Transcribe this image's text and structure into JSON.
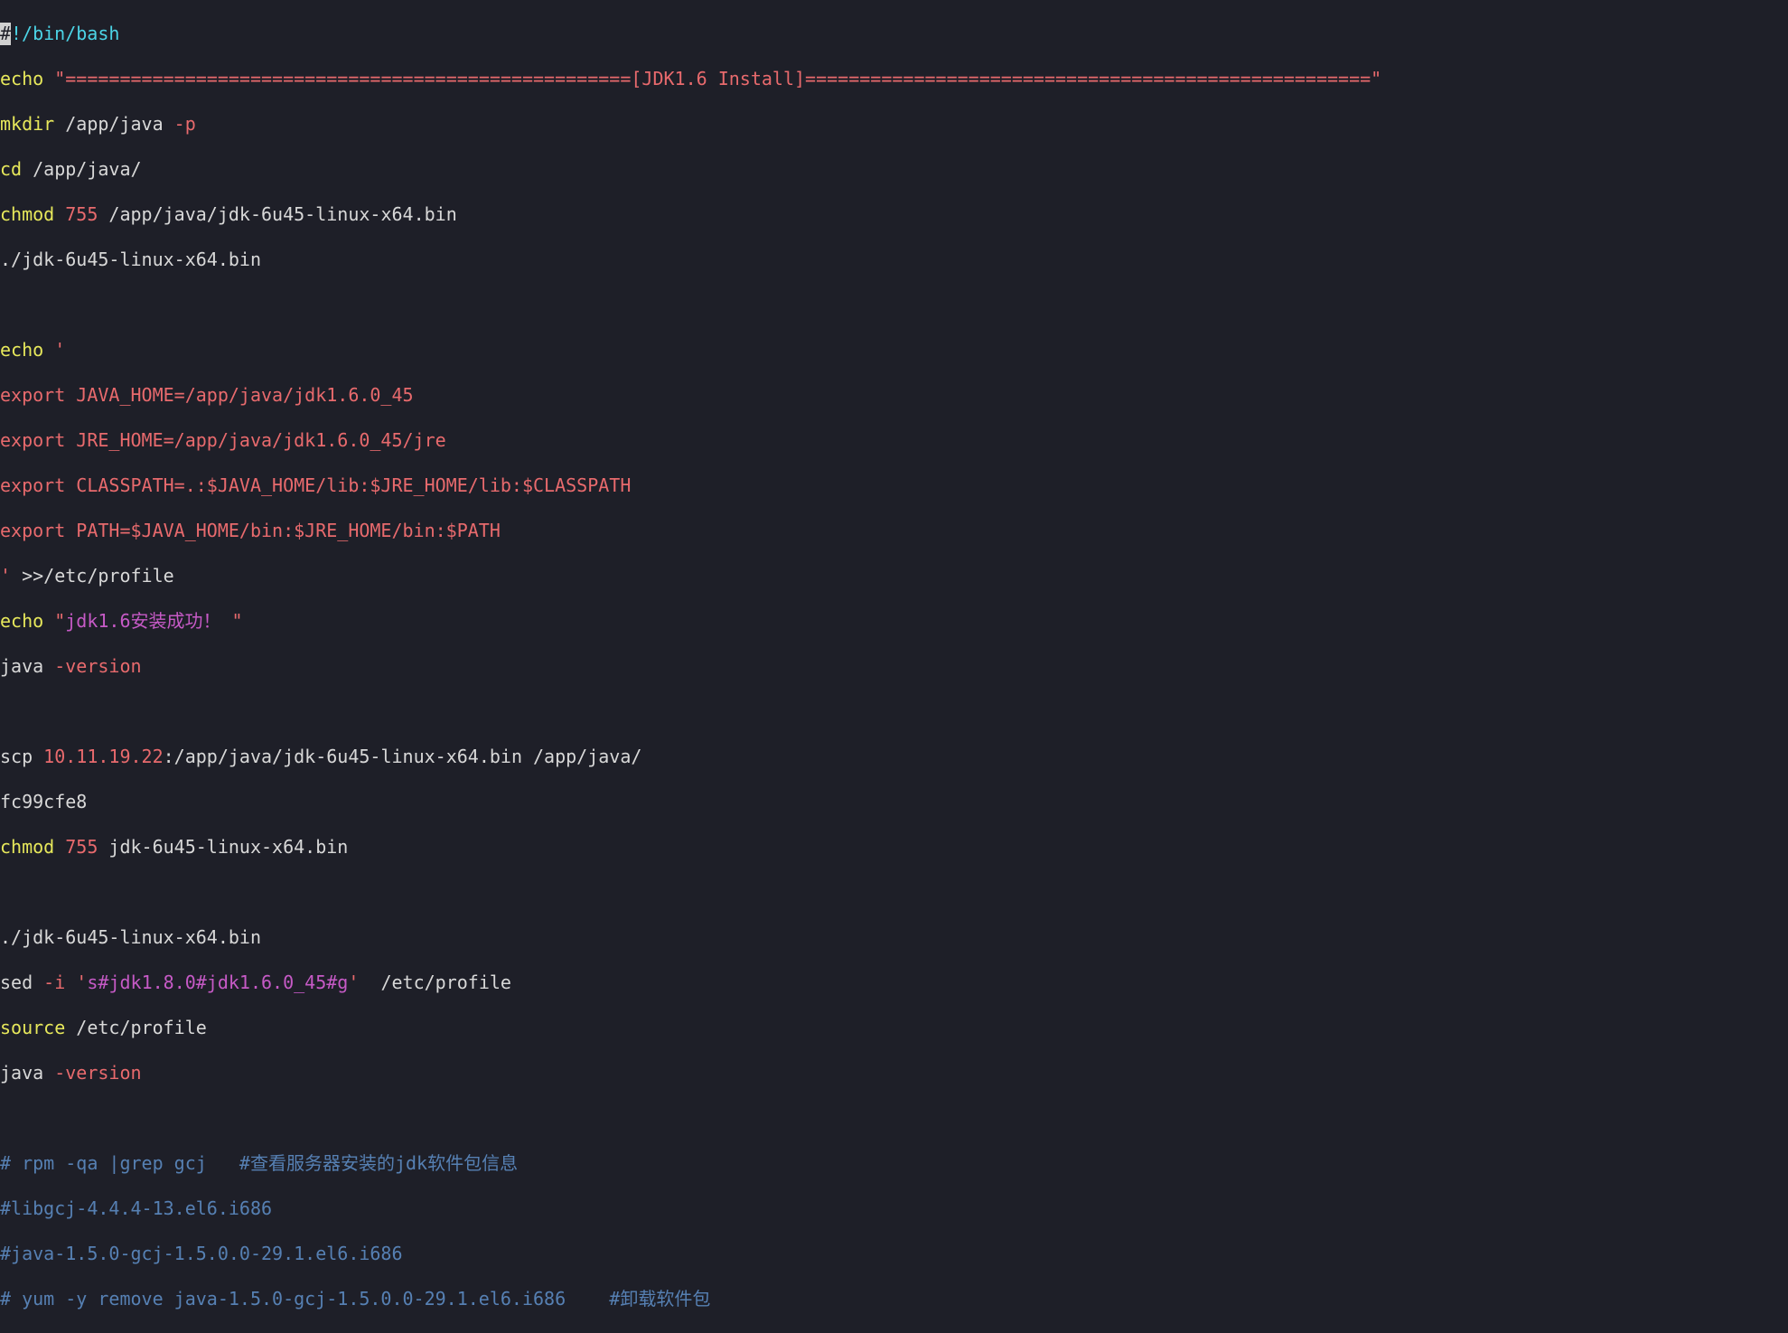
{
  "lines": {
    "l1_shebang": "!/bin/bash",
    "l2_echo": "echo",
    "l2_str": " \"====================================================[JDK1.6 Install]====================================================\"",
    "l3_mkdir": "mkdir",
    "l3_path": " /app/java ",
    "l3_flag": "-p",
    "l4_cd": "cd",
    "l4_path": " /app/java/",
    "l5_chmod": "chmod",
    "l5_num": " 755",
    "l5_path": " /app/java/jdk-6u45-linux-x64.bin",
    "l6_run": "./jdk-6u45-linux-x64.bin",
    "l7_blank": " ",
    "l8_echo": "echo",
    "l8_q": " '",
    "l9": "export JAVA_HOME=/app/java/jdk1.6.0_45",
    "l10": "export JRE_HOME=/app/java/jdk1.6.0_45/jre",
    "l11": "export CLASSPATH=.:$JAVA_HOME/lib:$JRE_HOME/lib:$CLASSPATH",
    "l12": "export PATH=$JAVA_HOME/bin:$JRE_HOME/bin:$PATH",
    "l13_q": "'",
    "l13_redir": " >>",
    "l13_path": "/etc/profile",
    "l14_echo": "echo",
    "l14_q1": " \"",
    "l14_str": "jdk1.6安装成功！",
    "l14_q2": " \"",
    "l15_java": "java ",
    "l15_flag": "-version",
    "l16_blank": " ",
    "l17_scp": "scp",
    "l17_ip": " 10.11.19.22",
    "l17_path": ":/app/java/jdk-6u45-linux-x64.bin /app/java/",
    "l18": "fc99cfe8",
    "l19_chmod": "chmod",
    "l19_num": " 755",
    "l19_path": " jdk-6u45-linux-x64.bin",
    "l20_blank": " ",
    "l21_run": "./jdk-6u45-linux-x64.bin",
    "l22_sed": "sed ",
    "l22_flag": "-i",
    "l22_q1": " '",
    "l22_str": "s#jdk1.8.0#jdk1.6.0_45#g",
    "l22_q2": "'",
    "l22_path": "  /etc/profile",
    "l23_src": "source",
    "l23_path": " /etc/profile",
    "l24_java": "java ",
    "l24_flag": "-version",
    "l25_blank": " ",
    "c1": "# rpm -qa |grep gcj   #查看服务器安装的jdk软件包信息",
    "c2": "#libgcj-4.4.4-13.el6.i686",
    "c3": "#java-1.5.0-gcj-1.5.0.0-29.1.el6.i686",
    "c4": "# yum -y remove java-1.5.0-gcj-1.5.0.0-29.1.el6.i686    #卸载软件包"
  }
}
